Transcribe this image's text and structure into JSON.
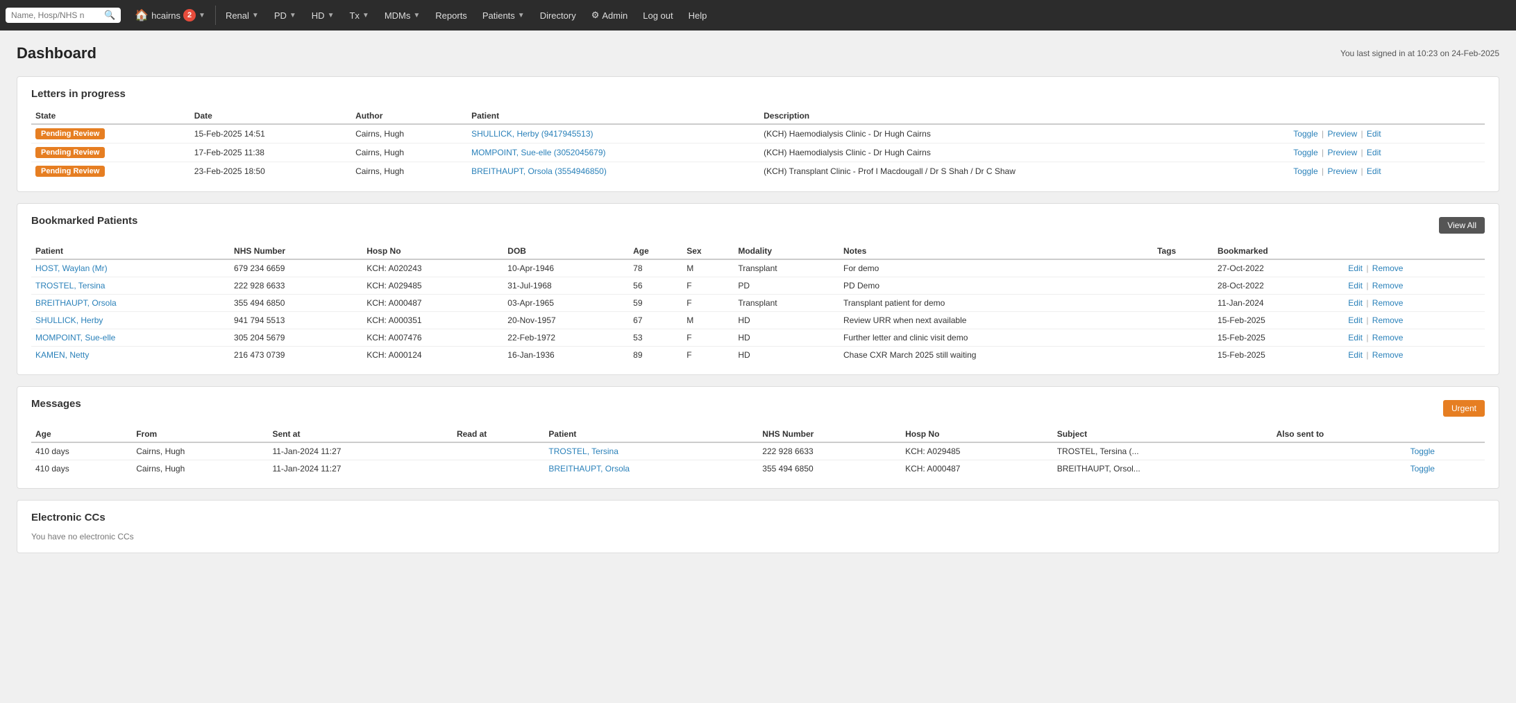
{
  "navbar": {
    "search_placeholder": "Name, Hosp/NHS n",
    "home_label": "hcairns",
    "home_badge": "2",
    "nav_items": [
      {
        "label": "Renal",
        "has_dropdown": true
      },
      {
        "label": "PD",
        "has_dropdown": true
      },
      {
        "label": "HD",
        "has_dropdown": true
      },
      {
        "label": "Tx",
        "has_dropdown": true
      },
      {
        "label": "MDMs",
        "has_dropdown": true
      },
      {
        "label": "Reports",
        "has_dropdown": false
      },
      {
        "label": "Patients",
        "has_dropdown": true
      },
      {
        "label": "Directory",
        "has_dropdown": false
      },
      {
        "label": "Admin",
        "has_dropdown": false,
        "has_gear": true
      },
      {
        "label": "Log out",
        "has_dropdown": false
      },
      {
        "label": "Help",
        "has_dropdown": false
      }
    ]
  },
  "page": {
    "title": "Dashboard",
    "last_signed": "You last signed in at 10:23 on 24-Feb-2025"
  },
  "letters_section": {
    "title": "Letters in progress",
    "columns": [
      "State",
      "Date",
      "Author",
      "Patient",
      "Description"
    ],
    "rows": [
      {
        "state": "Pending Review",
        "date": "15-Feb-2025 14:51",
        "author": "Cairns, Hugh",
        "patient": "SHULLICK, Herby (9417945513)",
        "description": "(KCH) Haemodialysis Clinic - Dr Hugh Cairns",
        "actions": [
          "Toggle",
          "Preview",
          "Edit"
        ]
      },
      {
        "state": "Pending Review",
        "date": "17-Feb-2025 11:38",
        "author": "Cairns, Hugh",
        "patient": "MOMPOINT, Sue-elle (3052045679)",
        "description": "(KCH) Haemodialysis Clinic - Dr Hugh Cairns",
        "actions": [
          "Toggle",
          "Preview",
          "Edit"
        ]
      },
      {
        "state": "Pending Review",
        "date": "23-Feb-2025 18:50",
        "author": "Cairns, Hugh",
        "patient": "BREITHAUPT, Orsola (3554946850)",
        "description": "(KCH) Transplant Clinic - Prof I Macdougall / Dr S Shah / Dr C Shaw",
        "actions": [
          "Toggle",
          "Preview",
          "Edit"
        ]
      }
    ]
  },
  "bookmarked_section": {
    "title": "Bookmarked Patients",
    "view_all_label": "View All",
    "columns": [
      "Patient",
      "NHS Number",
      "Hosp No",
      "DOB",
      "Age",
      "Sex",
      "Modality",
      "Notes",
      "Tags",
      "Bookmarked"
    ],
    "rows": [
      {
        "patient": "HOST, Waylan (Mr)",
        "nhs": "679 234 6659",
        "hosp": "KCH: A020243",
        "dob": "10-Apr-1946",
        "age": "78",
        "sex": "M",
        "modality": "Transplant",
        "notes": "For demo",
        "tags": "",
        "bookmarked": "27-Oct-2022"
      },
      {
        "patient": "TROSTEL, Tersina",
        "nhs": "222 928 6633",
        "hosp": "KCH: A029485",
        "dob": "31-Jul-1968",
        "age": "56",
        "sex": "F",
        "modality": "PD",
        "notes": "PD Demo",
        "tags": "",
        "bookmarked": "28-Oct-2022"
      },
      {
        "patient": "BREITHAUPT, Orsola",
        "nhs": "355 494 6850",
        "hosp": "KCH: A000487",
        "dob": "03-Apr-1965",
        "age": "59",
        "sex": "F",
        "modality": "Transplant",
        "notes": "Transplant patient for demo",
        "tags": "",
        "bookmarked": "11-Jan-2024"
      },
      {
        "patient": "SHULLICK, Herby",
        "nhs": "941 794 5513",
        "hosp": "KCH: A000351",
        "dob": "20-Nov-1957",
        "age": "67",
        "sex": "M",
        "modality": "HD",
        "notes": "Review URR when next available",
        "tags": "",
        "bookmarked": "15-Feb-2025"
      },
      {
        "patient": "MOMPOINT, Sue-elle",
        "nhs": "305 204 5679",
        "hosp": "KCH: A007476",
        "dob": "22-Feb-1972",
        "age": "53",
        "sex": "F",
        "modality": "HD",
        "notes": "Further letter and clinic visit demo",
        "tags": "",
        "bookmarked": "15-Feb-2025"
      },
      {
        "patient": "KAMEN, Netty",
        "nhs": "216 473 0739",
        "hosp": "KCH: A000124",
        "dob": "16-Jan-1936",
        "age": "89",
        "sex": "F",
        "modality": "HD",
        "notes": "Chase CXR March 2025 still waiting",
        "tags": "",
        "bookmarked": "15-Feb-2025"
      }
    ]
  },
  "messages_section": {
    "title": "Messages",
    "urgent_label": "Urgent",
    "columns": [
      "Age",
      "From",
      "Sent at",
      "Read at",
      "Patient",
      "NHS Number",
      "Hosp No",
      "Subject",
      "Also sent to"
    ],
    "rows": [
      {
        "age": "410 days",
        "from": "Cairns, Hugh",
        "sent_at": "11-Jan-2024 11:27",
        "read_at": "",
        "patient": "TROSTEL, Tersina",
        "nhs": "222 928 6633",
        "hosp": "KCH: A029485",
        "subject": "TROSTEL, Tersina (...",
        "also_sent_to": ""
      },
      {
        "age": "410 days",
        "from": "Cairns, Hugh",
        "sent_at": "11-Jan-2024 11:27",
        "read_at": "",
        "patient": "BREITHAUPT, Orsola",
        "nhs": "355 494 6850",
        "hosp": "KCH: A000487",
        "subject": "BREITHAUPT, Orsol...",
        "also_sent_to": ""
      }
    ]
  },
  "electronic_ccs_section": {
    "title": "Electronic CCs",
    "no_data_text": "You have no electronic CCs"
  },
  "actions": {
    "toggle": "Toggle",
    "preview": "Preview",
    "edit": "Edit",
    "remove": "Remove"
  }
}
